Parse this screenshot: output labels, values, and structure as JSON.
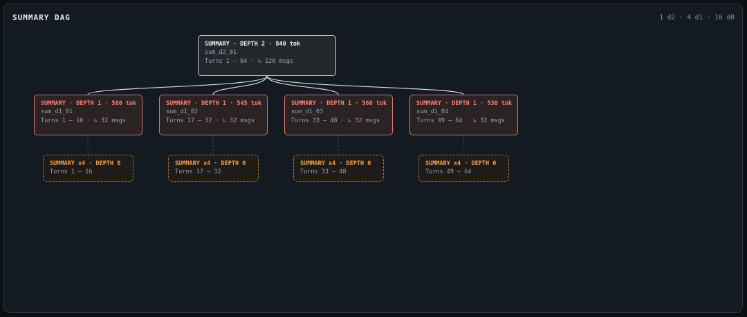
{
  "panel": {
    "title": "SUMMARY DAG",
    "stats": "1 d2 · 4 d1 · 16 d0"
  },
  "colors": {
    "background": "#141a21",
    "root_border": "#c9ced4",
    "depth1_accent": "#ff7c70",
    "depth0_accent": "#f1a049"
  },
  "root": {
    "header": "SUMMARY · DEPTH 2 · 840 tok",
    "id": "sum_d2_01",
    "meta": "Turns 1 – 64 · ↳ 128 msgs"
  },
  "depth1": [
    {
      "header": "SUMMARY · DEPTH 1 · 580 tok",
      "id": "sum_d1_01",
      "meta": "Turns 1 – 16 · ↳ 32 msgs"
    },
    {
      "header": "SUMMARY · DEPTH 1 · 545 tok",
      "id": "sum_d1_02",
      "meta": "Turns 17 – 32 · ↳ 32 msgs"
    },
    {
      "header": "SUMMARY · DEPTH 1 · 560 tok",
      "id": "sum_d1_03",
      "meta": "Turns 33 – 48 · ↳ 32 msgs"
    },
    {
      "header": "SUMMARY · DEPTH 1 · 530 tok",
      "id": "sum_d1_04",
      "meta": "Turns 49 – 64 · ↳ 32 msgs"
    }
  ],
  "depth0": [
    {
      "header": "SUMMARY x4 · DEPTH 0",
      "meta": "Turns 1 – 16"
    },
    {
      "header": "SUMMARY x4 · DEPTH 0",
      "meta": "Turns 17 – 32"
    },
    {
      "header": "SUMMARY x4 · DEPTH 0",
      "meta": "Turns 33 – 48"
    },
    {
      "header": "SUMMARY x4 · DEPTH 0",
      "meta": "Turns 49 – 64"
    }
  ]
}
